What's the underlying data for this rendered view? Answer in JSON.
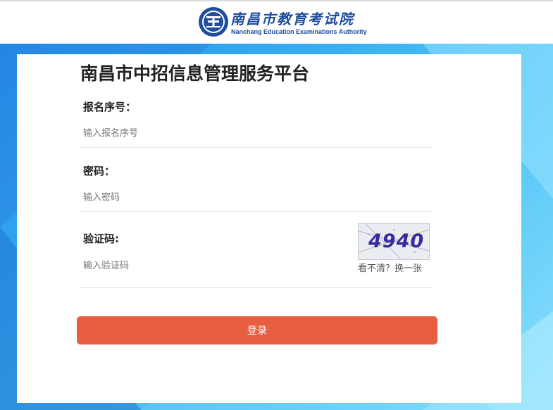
{
  "header": {
    "logo_cn": "南昌市教育考试院",
    "logo_en": "Nanchang Education Examinations Authority"
  },
  "colors": {
    "brand_blue": "#1f4e9e",
    "button": "#e85e41",
    "background_start": "#1f8fe8",
    "background_end": "#8ddffd"
  },
  "form": {
    "title": "南昌市中招信息管理服务平台",
    "reg_label": "报名序号：",
    "reg_placeholder": "输入报名序号",
    "pwd_label": "密码：",
    "pwd_placeholder": "输入密码",
    "captcha_label": "验证码:",
    "captcha_placeholder": "输入验证码",
    "captcha_text": "4940",
    "captcha_refresh": "看不清？换一张",
    "login_label": "登录"
  }
}
